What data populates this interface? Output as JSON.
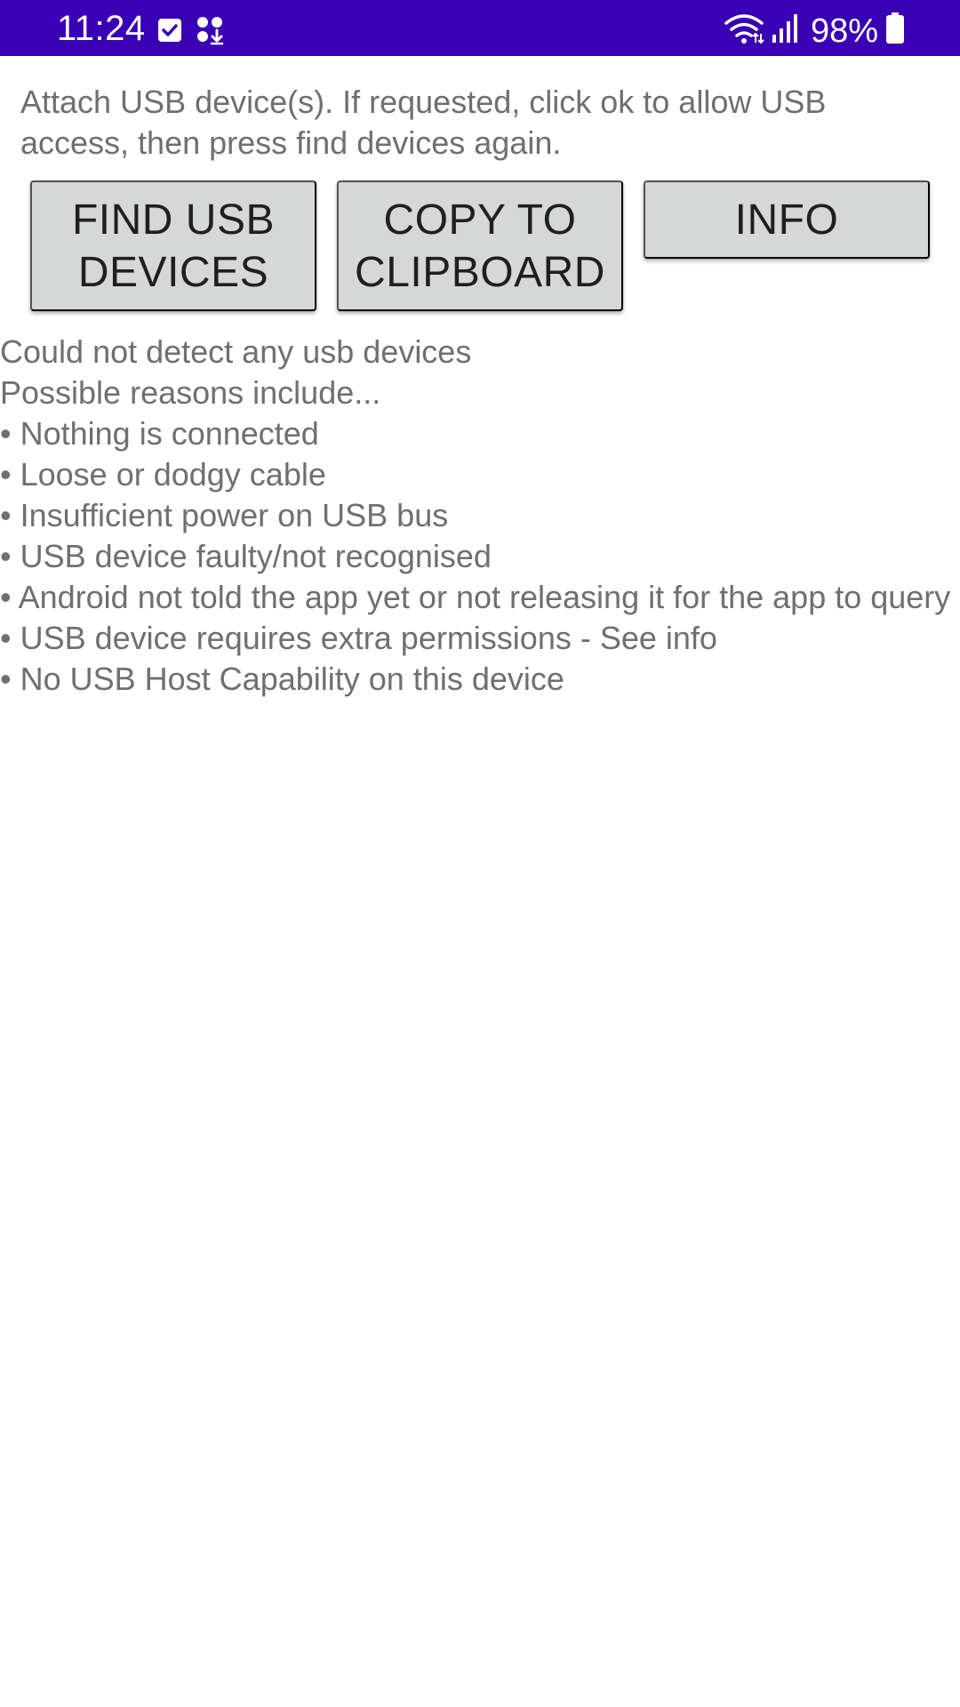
{
  "status_bar": {
    "time": "11:24",
    "battery": "98%",
    "background_color": "#3a00b3",
    "left_icons": [
      "checkbox-notification-icon",
      "apps-download-icon"
    ],
    "right_icons": [
      "wifi-icon",
      "cellular-signal-icon",
      "battery-icon"
    ]
  },
  "main": {
    "instructions": "Attach USB device(s).  If requested, click ok to allow USB access, then press find devices again.",
    "buttons": {
      "find_usb_devices": "FIND USB\nDEVICES",
      "copy_to_clipboard": "COPY TO\nCLIPBOARD",
      "info": "INFO"
    },
    "results": {
      "line1": "Could not detect any usb devices",
      "line2": "Possible reasons include...",
      "reasons": [
        "• Nothing is connected",
        "• Loose or dodgy cable",
        "• Insufficient power on USB bus",
        "• USB device faulty/not recognised",
        "• Android not told the app yet or not releasing it for the app to query",
        "• USB device requires extra permissions - See info",
        "• No USB Host Capability on this device"
      ]
    }
  }
}
